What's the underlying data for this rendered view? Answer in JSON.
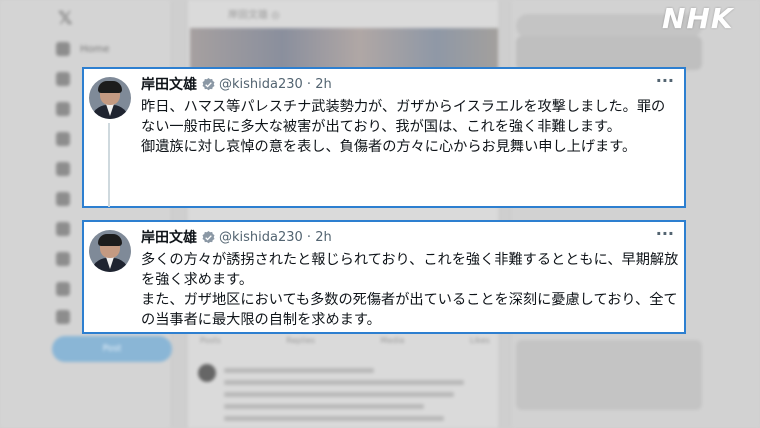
{
  "background": {
    "profile_name": "岸田文雄 ◎",
    "post_label": "Post",
    "nav_home": "Home",
    "tabs": [
      "Posts",
      "Replies",
      "Media",
      "Likes"
    ]
  },
  "brand": {
    "logo": "NHK"
  },
  "tweets": [
    {
      "name": "岸田文雄",
      "handle": "@kishida230 · 2h",
      "lines": [
        "昨日、ハマス等パレスチナ武装勢力が、ガザからイスラエルを攻撃しました。罪のない一般市民に多大な被害が出ており、我が国は、これを強く非難します。",
        "御遺族に対し哀悼の意を表し、負傷者の方々に心からお見舞い申し上げます。"
      ]
    },
    {
      "name": "岸田文雄",
      "handle": "@kishida230 · 2h",
      "lines": [
        "多くの方々が誘拐されたと報じられており、これを強く非難するとともに、早期解放を強く求めます。",
        "また、ガザ地区においても多数の死傷者が出ていることを深刻に憂慮しており、全ての当事者に最大限の自制を求めます。"
      ]
    }
  ],
  "colors": {
    "card_border": "#2d7fd0",
    "verified": "#8b98a5",
    "logo": "#ffffff"
  },
  "icons": {
    "verified": "verified-badge-icon",
    "more": "more-options-icon"
  }
}
